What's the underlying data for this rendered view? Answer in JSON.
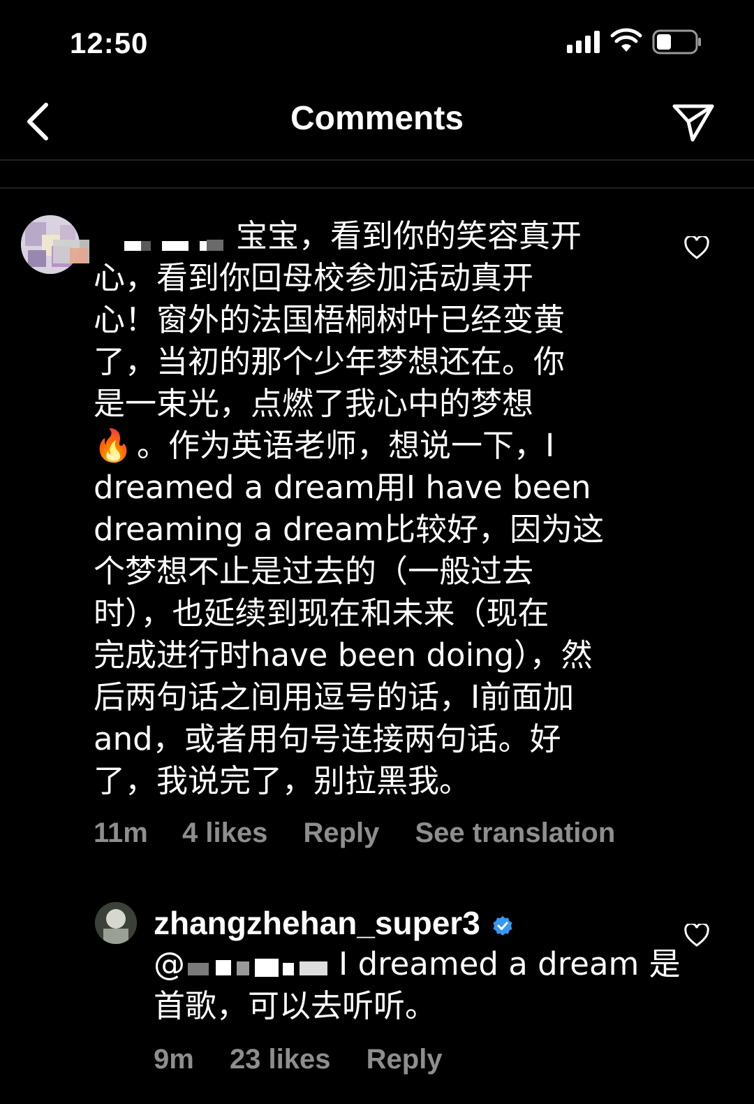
{
  "status_bar": {
    "time": "12:50"
  },
  "header": {
    "title": "Comments"
  },
  "comments": [
    {
      "username": "",
      "lines": [
        "宝宝，看到你的笑容真开",
        "心，看到你回母校参加活动真开",
        "心！窗外的法国梧桐树叶已经变黄",
        "了，当初的那个少年梦想还在。你",
        "是一束光，点燃了我心中的梦想",
        "。作为英语老师，想说一下，I",
        "dreamed a dream用I have been",
        "dreaming a dream比较好，因为这",
        "个梦想不止是过去的（一般过去",
        "时），也延续到现在和未来（现在",
        "完成进行时have been doing），然",
        "后两句话之间用逗号的话，I前面加",
        "and，或者用句号连接两句话。好",
        "了，我说完了，别拉黑我。"
      ],
      "emoji": "🔥",
      "time": "11m",
      "likes": "4 likes",
      "reply": "Reply",
      "translation": "See translation"
    },
    {
      "username": "zhangzhehan_super3",
      "mention": "@",
      "lines": [
        "I dreamed a dream 是",
        "首歌，可以去听听。"
      ],
      "time": "9m",
      "likes": "23 likes",
      "reply": "Reply"
    }
  ],
  "colors": {
    "background": "#000000",
    "text": "#ffffff",
    "meta": "#8e8e8e",
    "verified": "#3897f0"
  }
}
